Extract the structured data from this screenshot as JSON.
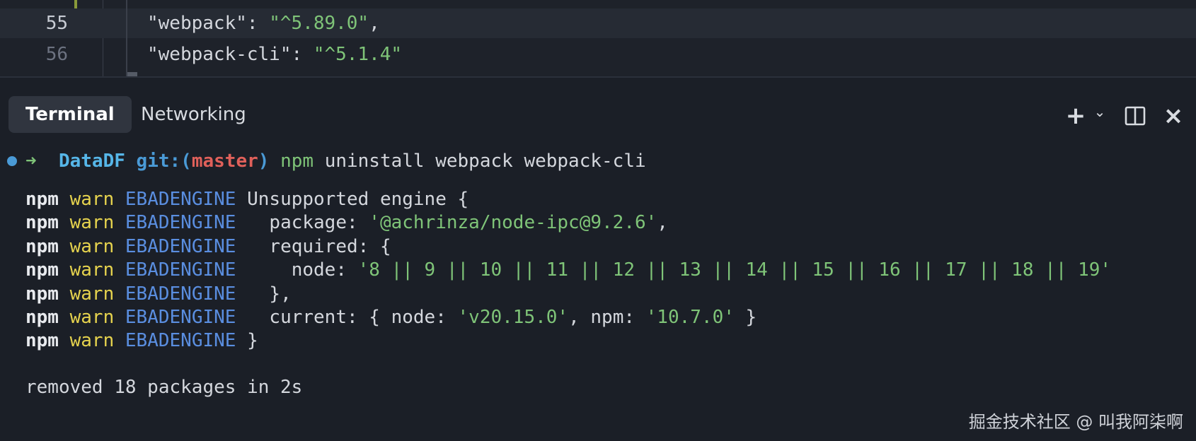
{
  "editor": {
    "lines": [
      {
        "number": "55",
        "key": "\"webpack\"",
        "sep": ": ",
        "value": "\"^5.89.0\"",
        "trail": ","
      },
      {
        "number": "56",
        "key": "\"webpack-cli\"",
        "sep": ": ",
        "value": "\"^5.1.4\"",
        "trail": ""
      }
    ]
  },
  "panel": {
    "tabs": [
      {
        "label": "Terminal",
        "active": true
      },
      {
        "label": "Networking",
        "active": false
      }
    ],
    "actions": {
      "new_icon": "plus-icon",
      "new_glyph": "+",
      "dropdown_glyph": "⌄",
      "split_icon": "split-panel-icon",
      "close_glyph": "×"
    }
  },
  "terminal": {
    "prompt": {
      "arrow": "➜",
      "dir": "DataDF",
      "git_prefix": "git:(",
      "branch": "master",
      "git_suffix": ")",
      "cmd": "npm",
      "args": "uninstall webpack webpack-cli"
    },
    "warn_lines": [
      {
        "npm": "npm",
        "level": "warn",
        "code": "EBADENGINE",
        "parts": [
          {
            "t": "plain",
            "v": " Unsupported engine {"
          }
        ]
      },
      {
        "npm": "npm",
        "level": "warn",
        "code": "EBADENGINE",
        "parts": [
          {
            "t": "plain",
            "v": "   package: "
          },
          {
            "t": "str",
            "v": "'@achrinza/node-ipc@9.2.6'"
          },
          {
            "t": "plain",
            "v": ","
          }
        ]
      },
      {
        "npm": "npm",
        "level": "warn",
        "code": "EBADENGINE",
        "parts": [
          {
            "t": "plain",
            "v": "   required: {"
          }
        ]
      },
      {
        "npm": "npm",
        "level": "warn",
        "code": "EBADENGINE",
        "parts": [
          {
            "t": "plain",
            "v": "     node: "
          },
          {
            "t": "str",
            "v": "'8 || 9 || 10 || 11 || 12 || 13 || 14 || 15 || 16 || 17 || 18 || 19'"
          }
        ]
      },
      {
        "npm": "npm",
        "level": "warn",
        "code": "EBADENGINE",
        "parts": [
          {
            "t": "plain",
            "v": "   },"
          }
        ]
      },
      {
        "npm": "npm",
        "level": "warn",
        "code": "EBADENGINE",
        "parts": [
          {
            "t": "plain",
            "v": "   current: { node: "
          },
          {
            "t": "str",
            "v": "'v20.15.0'"
          },
          {
            "t": "plain",
            "v": ", npm: "
          },
          {
            "t": "str",
            "v": "'10.7.0'"
          },
          {
            "t": "plain",
            "v": " }"
          }
        ]
      },
      {
        "npm": "npm",
        "level": "warn",
        "code": "EBADENGINE",
        "parts": [
          {
            "t": "plain",
            "v": " }"
          }
        ]
      }
    ],
    "result": "removed 18 packages in 2s"
  },
  "watermark": "掘金技术社区 @ 叫我阿柒啊",
  "colors": {
    "background": "#1b1f27",
    "string": "#7fc478",
    "warn": "#e6d34e",
    "engine": "#5a8ee0",
    "branch": "#e0605a"
  }
}
